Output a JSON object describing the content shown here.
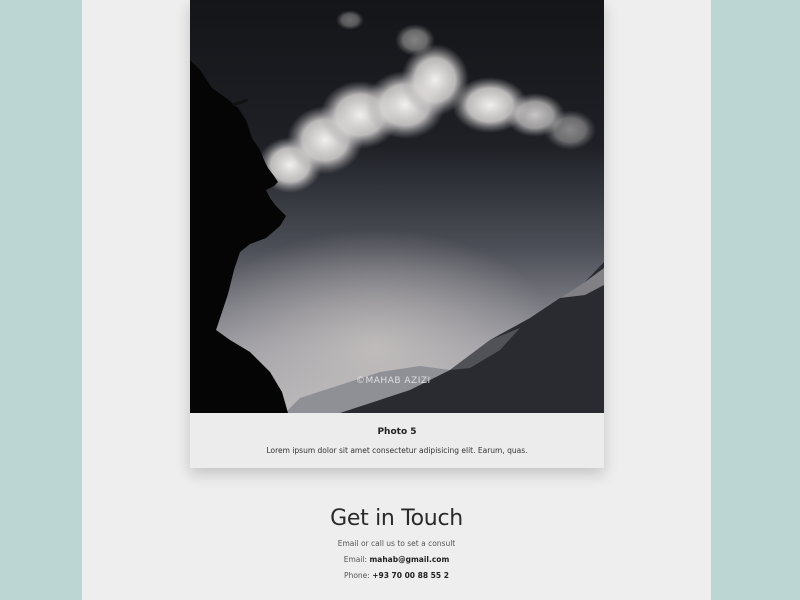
{
  "card": {
    "watermark": "©MAHAB AZIZI",
    "title": "Photo 5",
    "text": "Lorem ipsum dolor sit amet consectetur adipisicing elit. Earum, quas."
  },
  "contact": {
    "heading": "Get in Touch",
    "subtitle": "Email or call us to set a consult",
    "email_label": "Email: ",
    "email_value": "mahab@gmail.com",
    "phone_label": "Phone: ",
    "phone_value": "+93 70 00 88 55 2"
  },
  "colors": {
    "page_background": "#bcd7d3",
    "content_background": "#eeeeee",
    "card_background": "#ececec"
  }
}
